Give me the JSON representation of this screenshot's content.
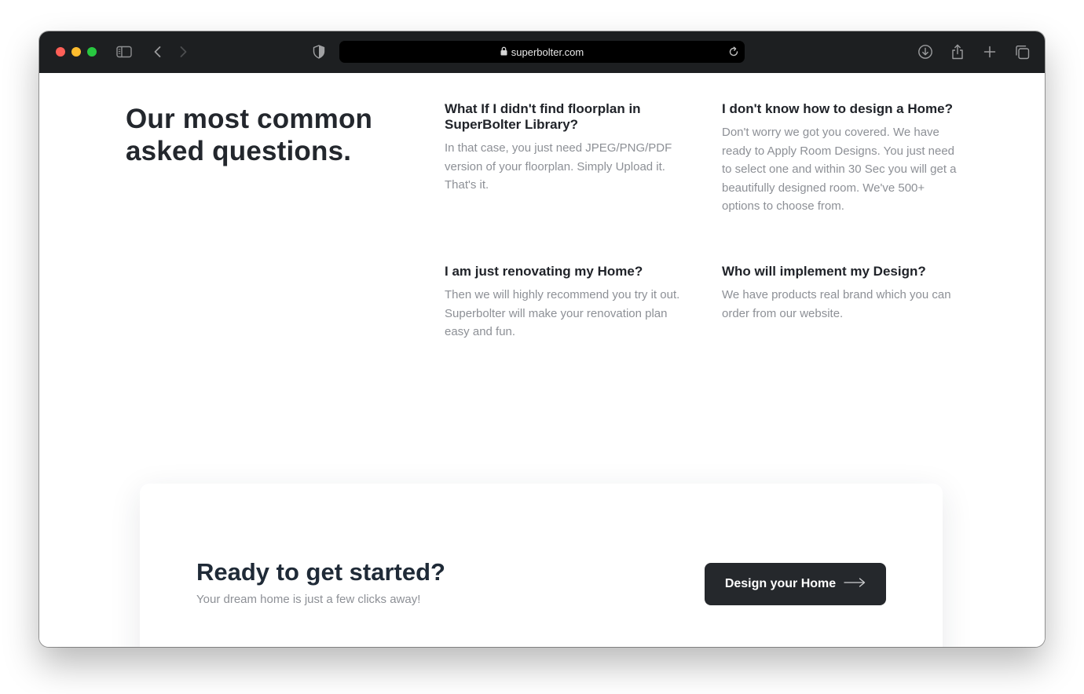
{
  "browser": {
    "url": "superbolter.com",
    "icons": [
      "sidebar-icon",
      "back-icon",
      "forward-icon",
      "shield-icon",
      "lock-icon",
      "reload-icon",
      "download-icon",
      "share-icon",
      "new-tab-icon",
      "tabs-overview-icon"
    ]
  },
  "faq": {
    "heading": "Our most common asked questions.",
    "items": [
      {
        "question": "What If I didn't find floorplan in SuperBolter Library?",
        "answer": "In that case, you just need JPEG/PNG/PDF version of your floorplan. Simply Upload it. That's it."
      },
      {
        "question": "I don't know how to design a Home?",
        "answer": "Don't worry we got you covered. We have ready to Apply Room Designs. You just need to select one and within 30 Sec you will get a beautifully designed room. We've 500+ options to choose from."
      },
      {
        "question": "I am just renovating my Home?",
        "answer": "Then we will highly recommend you try it out. Superbolter will make your renovation plan easy and fun."
      },
      {
        "question": "Who will implement my Design?",
        "answer": "We have products real brand which you can order from our website."
      }
    ]
  },
  "cta": {
    "title": "Ready to get started?",
    "subtitle": "Your dream home is just a few clicks away!",
    "button_label": "Design your Home",
    "button_icon": "arrow-right-icon"
  },
  "colors": {
    "toolbar": "#1d1f21",
    "heading_text": "#23272d",
    "muted_text": "#8d9096",
    "button_bg": "#25282c",
    "cta_title": "#1f2a37"
  }
}
